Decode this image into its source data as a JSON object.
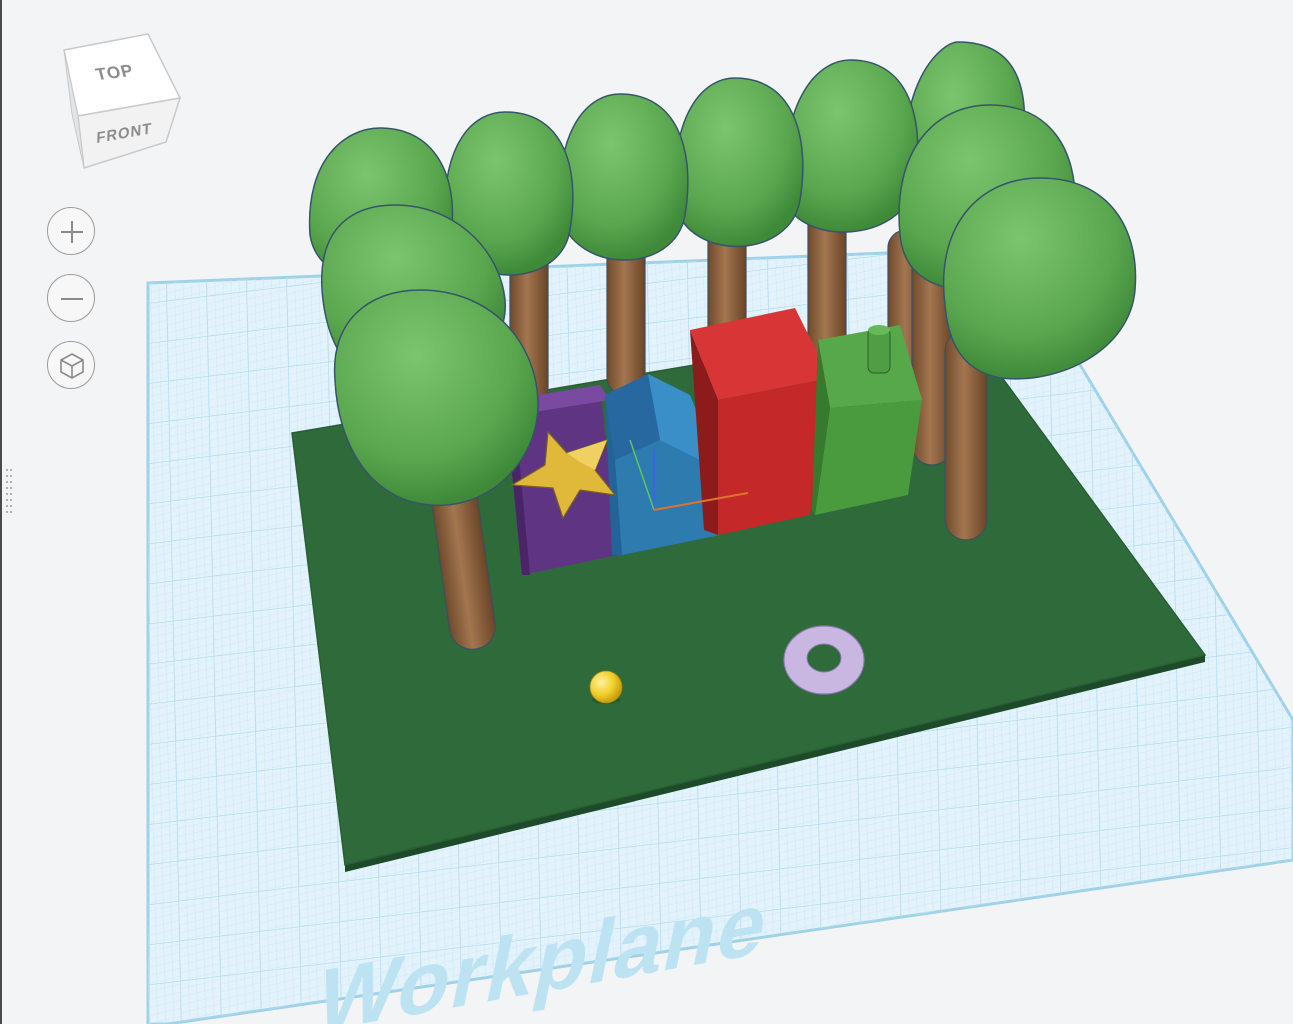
{
  "view_cube": {
    "top_label": "TOP",
    "front_label": "FRONT"
  },
  "nav_controls": [
    {
      "name": "zoom-in",
      "icon": "plus-icon"
    },
    {
      "name": "zoom-out",
      "icon": "minus-icon"
    },
    {
      "name": "home-view",
      "icon": "cube-home-icon"
    }
  ],
  "workplane": {
    "label": "Workplane"
  },
  "colors": {
    "workplane_grid": "#bfe4f5",
    "workplane_fill": "#e2f3fb",
    "base_plate": "#2e6a3c",
    "tree_canopy": "#5daa52",
    "tree_trunk": "#8e6440",
    "purple_block": "#6b3a8c",
    "star": "#e7c23a",
    "blue_house": "#2f7fb5",
    "red_block": "#c92a2a",
    "green_block": "#4f9e43",
    "sphere": "#f2cf2a",
    "torus": "#c7b4e0"
  }
}
